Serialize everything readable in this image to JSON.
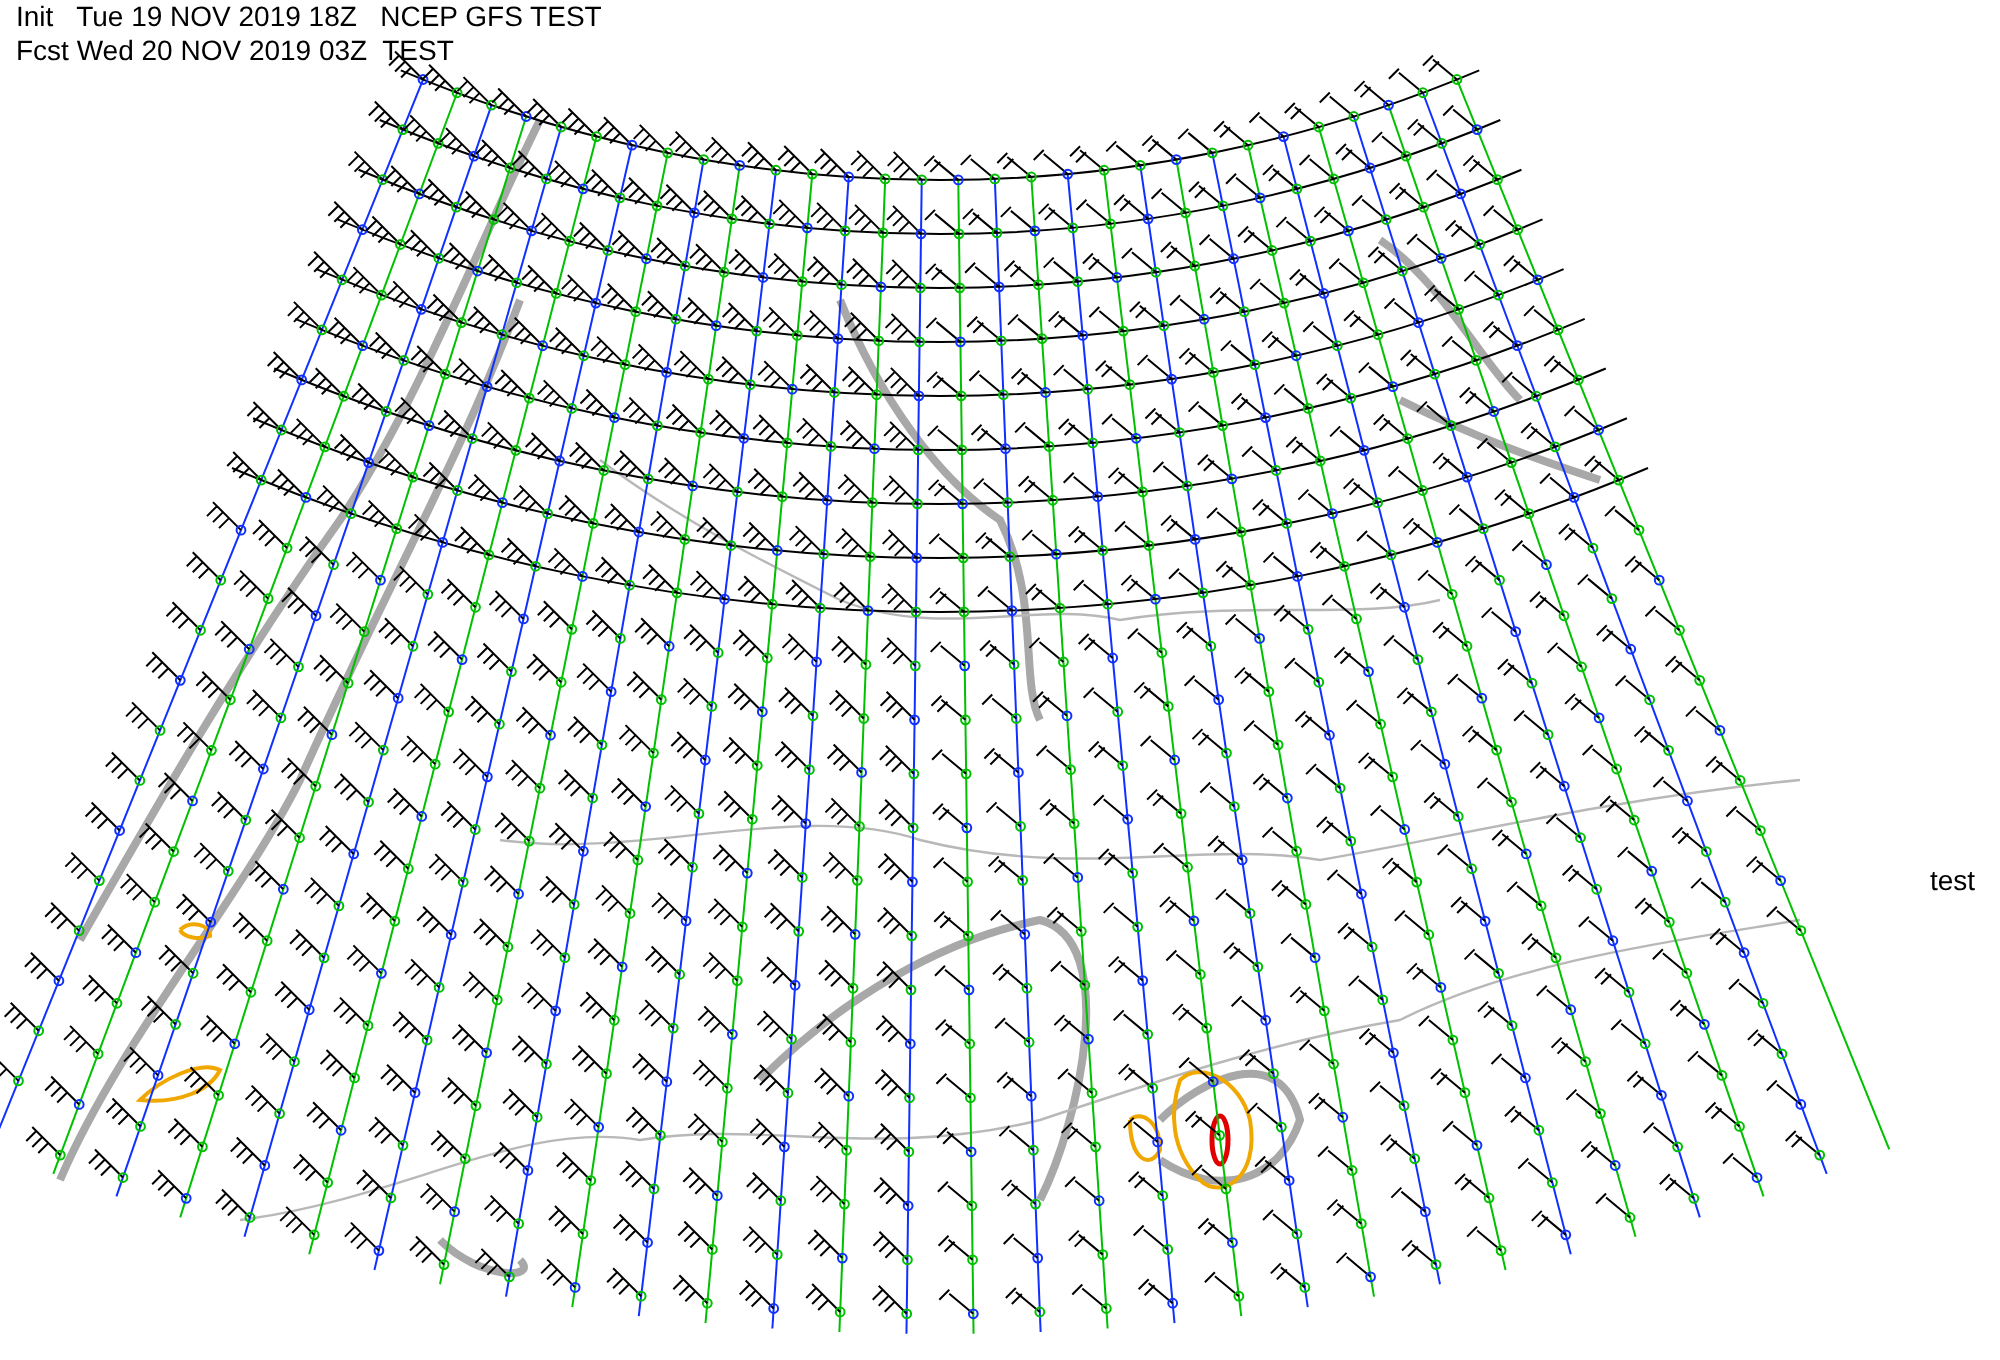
{
  "header": {
    "init_line": "Init   Tue 19 NOV 2019 18Z   NCEP GFS TEST",
    "forecast_line": "Fcst Wed 20 NOV 2019 03Z  TEST"
  },
  "side_label": "test"
}
